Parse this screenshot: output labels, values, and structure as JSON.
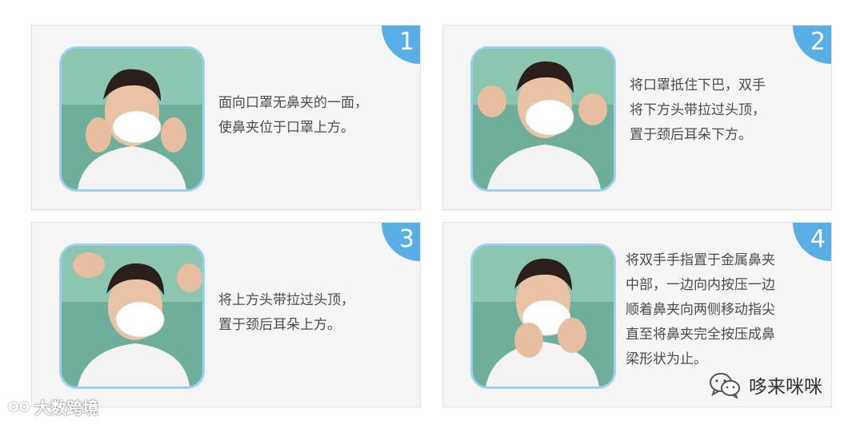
{
  "steps": [
    {
      "number": "1",
      "text": "面向口罩无鼻夹的一面，\n使鼻夹位于口罩上方。"
    },
    {
      "number": "2",
      "text": "将口罩抵住下巴，双手\n将下方头带拉过头顶，\n置于颈后耳朵下方。"
    },
    {
      "number": "3",
      "text": "将上方头带拉过头顶，\n置于颈后耳朵上方。"
    },
    {
      "number": "4",
      "text": "将双手手指置于金属鼻夹\n中部，一边向内按压一边\n顺着鼻夹向两侧移动指尖\n直至将鼻夹完全按压成鼻\n梁形状为止。"
    }
  ],
  "watermark_left": {
    "logo": "OO",
    "text": "大数跨境"
  },
  "watermark_right": {
    "icon": "wechat-icon",
    "text": "哆来咪咪"
  },
  "colors": {
    "accent": "#5aaee6",
    "photo_border": "#9cd0f2",
    "card_bg": "#f5f5f5"
  }
}
